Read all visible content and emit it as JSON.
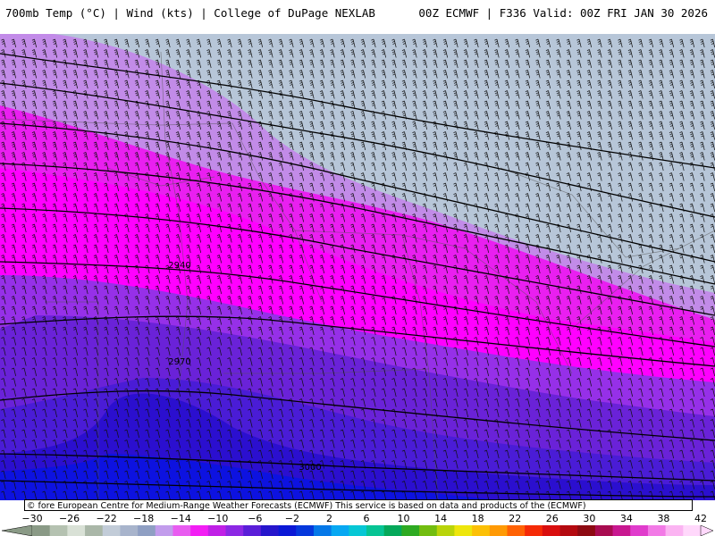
{
  "header": {
    "title_left": "700mb Temp (°C) | Wind (kts) | College of DuPage NEXLAB",
    "title_right": "00Z ECMWF | F336 Valid: 00Z FRI JAN 30 2026"
  },
  "map": {
    "contour_labels": [
      {
        "id": "h2940",
        "text": "2940"
      },
      {
        "id": "h2970",
        "text": "2970"
      },
      {
        "id": "h3000",
        "text": "3000"
      }
    ],
    "fill_colors": {
      "coldest": "#b7c6d8",
      "lavender": "#c28be8",
      "magenta": "#e91ff0",
      "bright_magenta": "#ff00ff",
      "purple": "#9630e8",
      "violet": "#6a22d8",
      "blue_violet": "#4a1cd6",
      "deep_blue": "#2b0fcf",
      "blue": "#0d12e0"
    },
    "barb_color": "#111111",
    "contour_color": "#000000"
  },
  "copyright": "© fore European Centre for Medium-Range Weather Forecasts (ECMWF)  This service is based on data and products of the (ECMWF)",
  "colorbar": {
    "tick_labels": [
      "−30",
      "−26",
      "−22",
      "−18",
      "−14",
      "−10",
      "−6",
      "−2",
      "2",
      "6",
      "10",
      "14",
      "18",
      "22",
      "26",
      "30",
      "34",
      "38",
      "42"
    ],
    "colors": [
      "#8a9a86",
      "#b5c2b1",
      "#d9e1d6",
      "#aab7a8",
      "#c2ccd8",
      "#a8b4cc",
      "#8f9fc3",
      "#c29cec",
      "#e85cf0",
      "#f21ef4",
      "#c020e6",
      "#8c28e4",
      "#5a1ed8",
      "#2616cc",
      "#0b18d6",
      "#0538dc",
      "#0578e8",
      "#07a8f2",
      "#06c7d5",
      "#06c494",
      "#05a85a",
      "#2eaa22",
      "#72bd10",
      "#b9d40a",
      "#eee60c",
      "#fcc006",
      "#ff9a05",
      "#ff6204",
      "#f52a06",
      "#d90e0e",
      "#b40a10",
      "#8d0a12",
      "#a80c50",
      "#c81890",
      "#e03ccc",
      "#f27ae6",
      "#fbb4f2",
      "#ffd8fb"
    ]
  }
}
